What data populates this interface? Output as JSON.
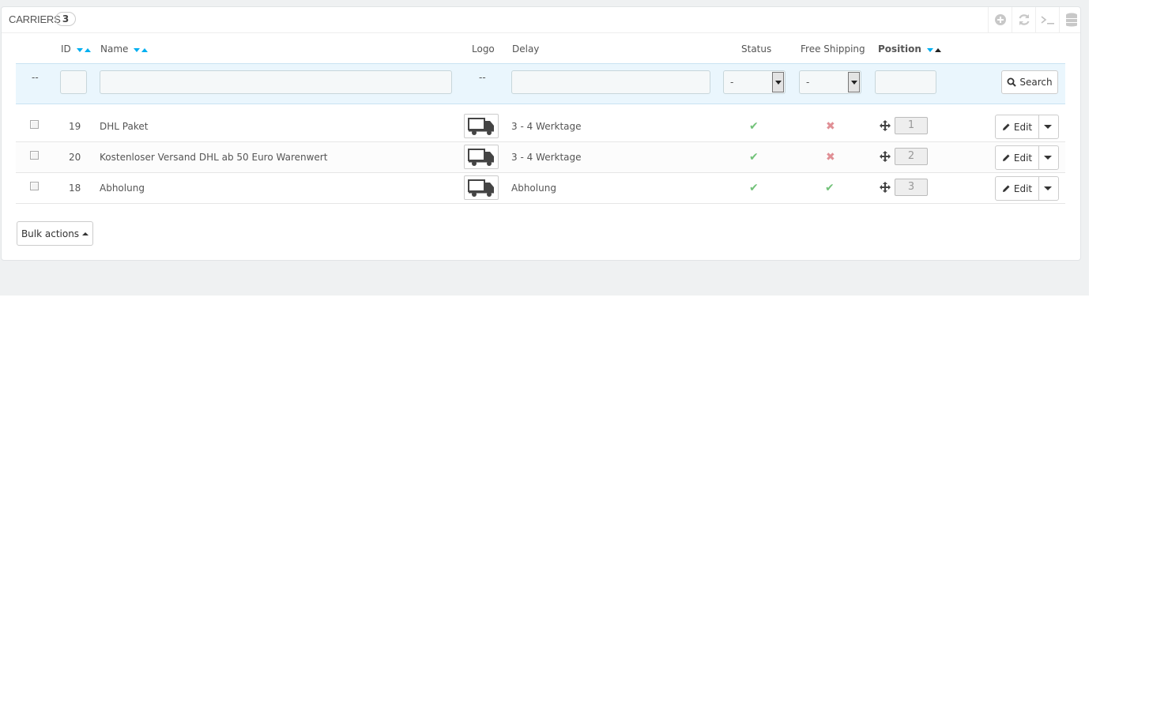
{
  "panel": {
    "title": "CARRIERS",
    "count": "3",
    "toolbar": [
      {
        "name": "add-new-icon"
      },
      {
        "name": "refresh-icon"
      },
      {
        "name": "sql-query-icon"
      },
      {
        "name": "export-database-icon"
      }
    ]
  },
  "columns": {
    "id": "ID",
    "name": "Name",
    "logo": "Logo",
    "delay": "Delay",
    "status": "Status",
    "free_shipping": "Free Shipping",
    "position": "Position"
  },
  "filters": {
    "checkbox_placeholder": "--",
    "logo_placeholder": "--",
    "status_value": "-",
    "free_shipping_value": "-",
    "search_label": "Search"
  },
  "rows": [
    {
      "id": "19",
      "name": "DHL Paket",
      "delay": "3 - 4 Werktage",
      "status": "enabled",
      "free_shipping": "no",
      "position": "1",
      "edit_label": "Edit"
    },
    {
      "id": "20",
      "name": "Kostenloser Versand DHL ab 50 Euro Warenwert",
      "delay": "3 - 4 Werktage",
      "status": "enabled",
      "free_shipping": "no",
      "position": "2",
      "edit_label": "Edit"
    },
    {
      "id": "18",
      "name": "Abholung",
      "delay": "Abholung",
      "status": "enabled",
      "free_shipping": "yes",
      "position": "3",
      "edit_label": "Edit"
    }
  ],
  "bulk_actions_label": "Bulk actions",
  "colors": {
    "accent": "#00aff0",
    "ok": "#72c279",
    "ko": "#e08f95",
    "filter_bg": "#eaf6fd"
  }
}
